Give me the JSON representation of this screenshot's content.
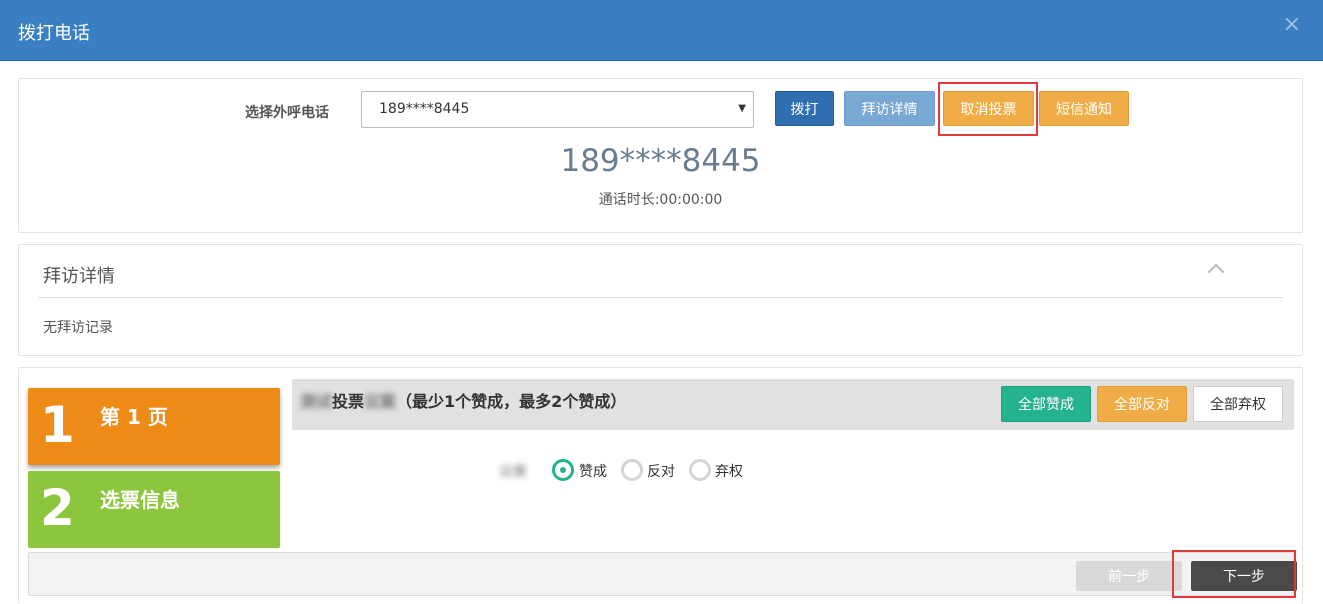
{
  "dialog": {
    "title": "拨打电话",
    "close_icon": "×"
  },
  "call": {
    "select_label": "选择外呼电话",
    "selected_phone": "189****8445",
    "caret": "▼",
    "buttons": {
      "dial": "拨打",
      "visit_detail": "拜访详情",
      "cancel_vote": "取消投票",
      "sms_notify": "短信通知"
    },
    "display_number": "189****8445",
    "duration": "通话时长:00:00:00"
  },
  "visit": {
    "title": "拜访详情",
    "empty_text": "无拜访记录"
  },
  "vote": {
    "steps": [
      {
        "num": "1",
        "label": "第 1 页"
      },
      {
        "num": "2",
        "label": "选票信息"
      }
    ],
    "topic": {
      "blur_1": "测试",
      "mid": "投票",
      "blur_2": "议案",
      "suffix": "（最少1个赞成，最多2个赞成）"
    },
    "bulk_buttons": {
      "all_yes": "全部赞成",
      "all_no": "全部反对",
      "all_abstain": "全部弃权"
    },
    "option": {
      "name": "议案",
      "yes": "赞成",
      "no": "反对",
      "abstain": "弃权",
      "selected": "yes"
    },
    "nav": {
      "prev": "前一步",
      "next": "下一步"
    }
  },
  "colors": {
    "header": "#3a7fc2",
    "primary": "#2e6eb1",
    "warning": "#f0ac47",
    "success": "#23b48e",
    "step1": "#ee8a16",
    "step2": "#8cc63c",
    "highlight": "#e0393c"
  }
}
